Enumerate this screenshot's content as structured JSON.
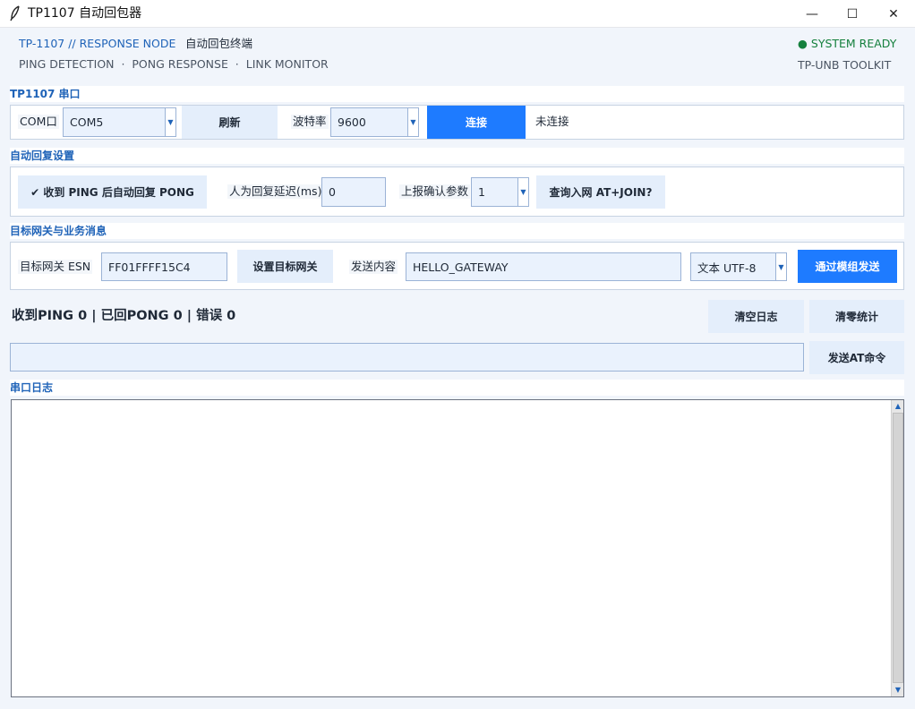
{
  "window": {
    "title": "TP1107 自动回包器",
    "icon": "feather-icon",
    "minimize": "—",
    "maximize": "☐",
    "close": "✕"
  },
  "header": {
    "node_label": "TP-1107 // RESPONSE NODE",
    "node_desc": "自动回包终端",
    "subtitle": "PING DETECTION  ·  PONG RESPONSE  ·  LINK MONITOR",
    "status": "● SYSTEM READY",
    "toolkit": "TP-UNB TOOLKIT"
  },
  "serial": {
    "section_title": "TP1107 串口",
    "com_label": "COM口",
    "com_value": "COM5",
    "refresh": "刷新",
    "baud_label": "波特率",
    "baud_value": "9600",
    "connect": "连接",
    "conn_status": "未连接"
  },
  "auto_reply": {
    "section_title": "自动回复设置",
    "toggle": "✔ 收到 PING 后自动回复 PONG",
    "delay_label": "人为回复延迟(ms)",
    "delay_value": "0",
    "ack_label": "上报确认参数",
    "ack_value": "1",
    "query": "查询入网 AT+JOIN?"
  },
  "gateway": {
    "section_title": "目标网关与业务消息",
    "esn_label": "目标网关 ESN",
    "esn_value": "FF01FFFF15C4",
    "set_gateway": "设置目标网关",
    "content_label": "发送内容",
    "content_value": "HELLO_GATEWAY",
    "encoding_value": "文本 UTF-8",
    "send": "通过模组发送"
  },
  "stats": {
    "text": "收到PING 0 | 已回PONG 0 | 错误 0",
    "clear_log": "清空日志",
    "reset_stats": "清零统计"
  },
  "at": {
    "input_value": "",
    "send_at": "发送AT命令"
  },
  "log": {
    "section_title": "串口日志",
    "scroll_up": "▲",
    "scroll_down": "▼"
  },
  "colors": {
    "accent": "#1e7bff",
    "label_blue": "#1f63b8",
    "status_green": "#15803d"
  }
}
